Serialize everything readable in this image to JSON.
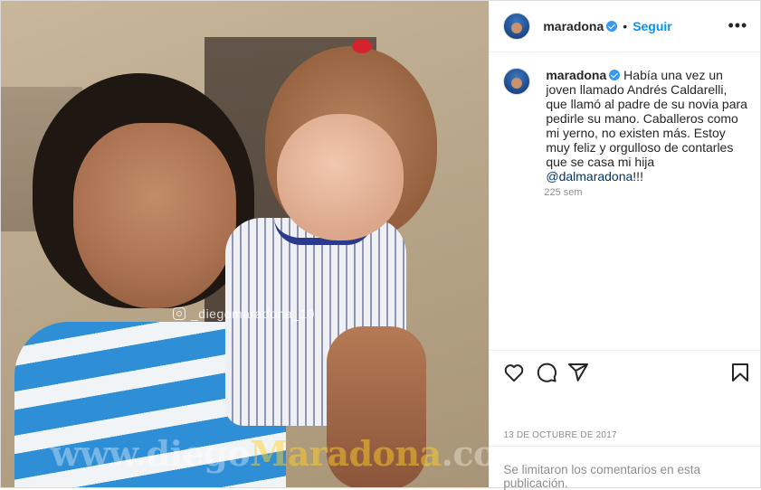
{
  "post": {
    "photo": {
      "watermark_handle": "_diegomaradona_10",
      "watermark_site_start": "www.diego",
      "watermark_site_mid": "Maradona",
      "watermark_site_end": ".com"
    },
    "header": {
      "username": "maradona",
      "separator": "•",
      "follow_label": "Seguir",
      "more_icon": "more-options-icon",
      "more_glyph": "•••"
    },
    "caption": {
      "username": "maradona",
      "text": "Había una vez un joven llamado Andrés Caldarelli, que llamó al padre de su novia para pedirle su mano. Caballeros como mi yerno, no existen más. Estoy muy feliz y orgulloso de contarles que se casa mi hija ",
      "mention": "@dalmaradona",
      "suffix": "!!!",
      "time_ago": "225 sem"
    },
    "actions": {
      "icons": [
        "heart-icon",
        "comment-icon",
        "share-icon",
        "bookmark-icon"
      ]
    },
    "date": "13 DE OCTUBRE DE 2017",
    "comments_disabled": "Se limitaron los comentarios en esta publicación.",
    "colors": {
      "link_blue": "#0095f6",
      "verified_blue": "#3897f0",
      "secondary_text": "#8e8e8e",
      "border": "#efefef"
    }
  }
}
